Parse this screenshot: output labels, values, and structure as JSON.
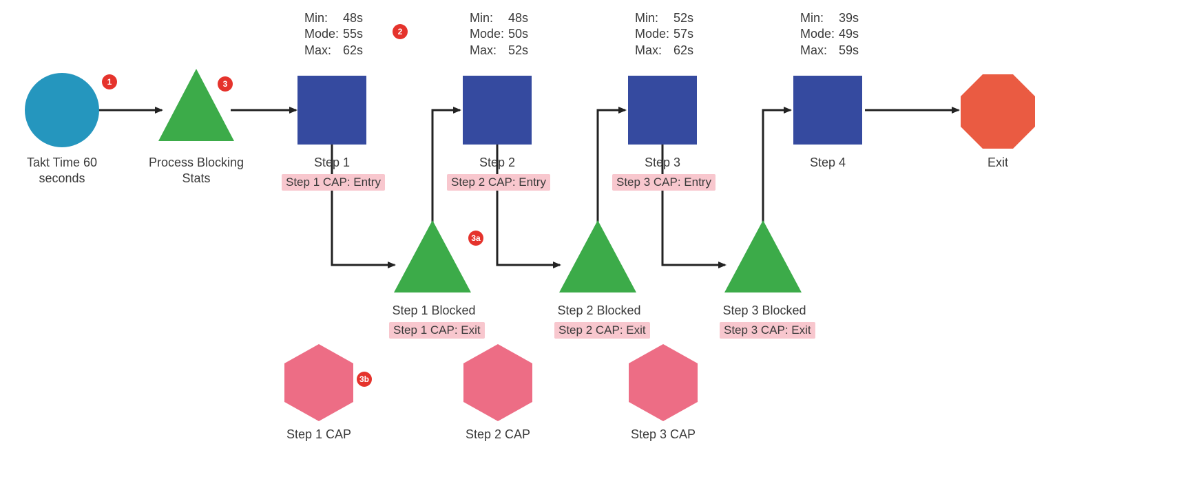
{
  "colors": {
    "circle": "#2596be",
    "triangle": "#3cab49",
    "square": "#354a9f",
    "octagon": "#ea5b42",
    "hexagon": "#ed6d85",
    "badge": "#e5332c",
    "cap_bg": "#f8c7ce",
    "arrow": "#222222"
  },
  "nodes": {
    "source": {
      "label": "Takt Time 60 seconds"
    },
    "blocking_stats": {
      "label": "Process Blocking Stats"
    },
    "step1": {
      "label": "Step 1",
      "cap_entry": "Step 1 CAP: Entry",
      "stats": {
        "min_label": "Min:",
        "min_val": "48s",
        "mode_label": "Mode:",
        "mode_val": "55s",
        "max_label": "Max:",
        "max_val": "62s"
      }
    },
    "step2": {
      "label": "Step 2",
      "cap_entry": "Step 2 CAP: Entry",
      "stats": {
        "min_label": "Min:",
        "min_val": "48s",
        "mode_label": "Mode:",
        "mode_val": "50s",
        "max_label": "Max:",
        "max_val": "52s"
      }
    },
    "step3": {
      "label": "Step 3",
      "cap_entry": "Step 3 CAP: Entry",
      "stats": {
        "min_label": "Min:",
        "min_val": "52s",
        "mode_label": "Mode:",
        "mode_val": "57s",
        "max_label": "Max:",
        "max_val": "62s"
      }
    },
    "step4": {
      "label": "Step 4",
      "stats": {
        "min_label": "Min:",
        "min_val": "39s",
        "mode_label": "Mode:",
        "mode_val": "49s",
        "max_label": "Max:",
        "max_val": "59s"
      }
    },
    "exit": {
      "label": "Exit"
    },
    "step1_blocked": {
      "label": "Step 1 Blocked",
      "cap_exit": "Step 1 CAP: Exit"
    },
    "step2_blocked": {
      "label": "Step 2 Blocked",
      "cap_exit": "Step 2 CAP: Exit"
    },
    "step3_blocked": {
      "label": "Step 3 Blocked",
      "cap_exit": "Step 3 CAP: Exit"
    },
    "step1_cap": {
      "label": "Step 1 CAP"
    },
    "step2_cap": {
      "label": "Step 2 CAP"
    },
    "step3_cap": {
      "label": "Step 3 CAP"
    }
  },
  "badges": {
    "b1": "1",
    "b2": "2",
    "b3": "3",
    "b3a": "3a",
    "b3b": "3b"
  }
}
